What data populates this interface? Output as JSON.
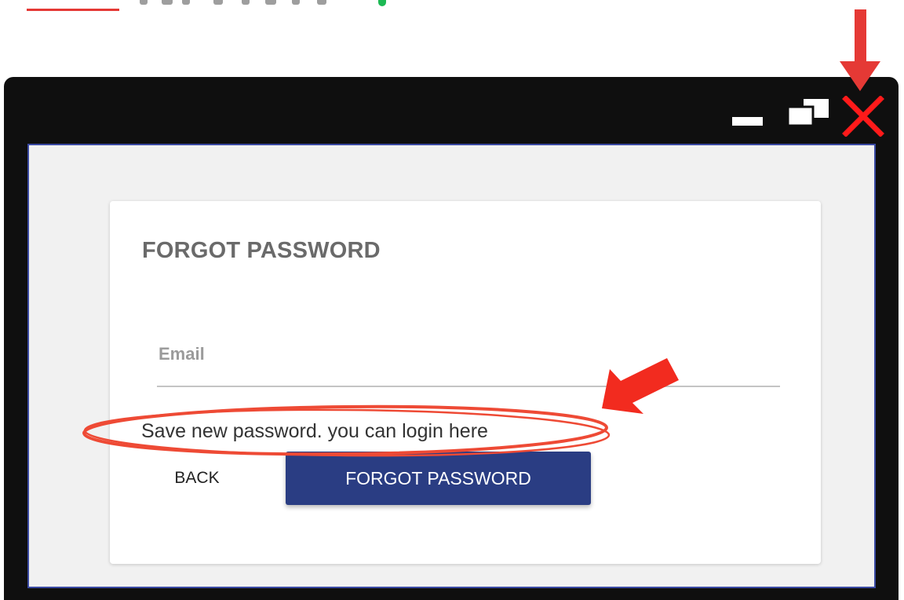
{
  "colors": {
    "window_frame": "#0f0f0f",
    "content_bg": "#f1f1f1",
    "content_border": "#3a4aa3",
    "primary_button": "#2a3d83",
    "annotation_red": "#e53935",
    "close_icon": "#ff1a1a"
  },
  "window": {
    "controls": {
      "minimize_icon": "minimize-icon",
      "restore_icon": "restore-icon",
      "close_icon": "close-icon"
    }
  },
  "form": {
    "title": "FORGOT PASSWORD",
    "email_label": "Email",
    "email_value": "",
    "message": "Save new password. you can login here",
    "back_label": "BACK",
    "submit_label": "FORGOT PASSWORD"
  },
  "annotations": {
    "icons": [
      "down-arrow-icon",
      "diagonal-arrow-icon",
      "highlight-ellipse"
    ]
  }
}
